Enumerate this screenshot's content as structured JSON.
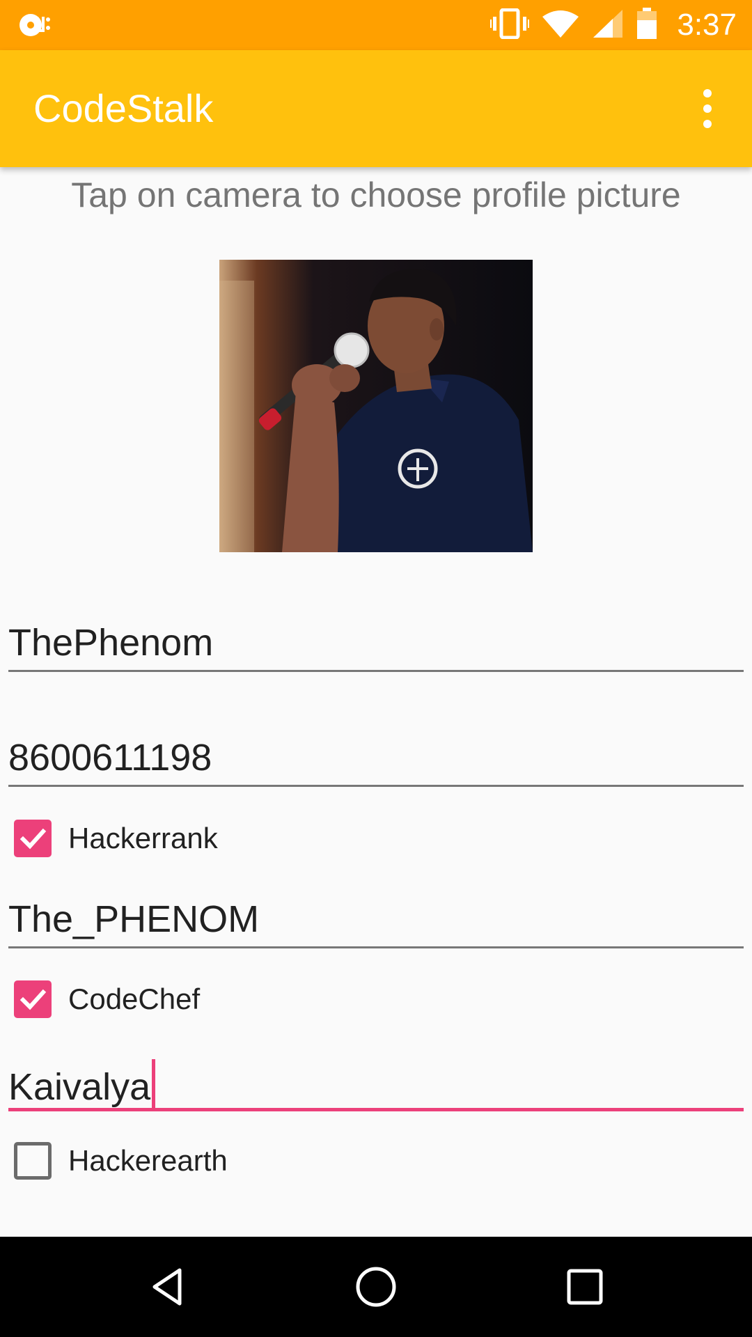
{
  "status_bar": {
    "time": "3:37",
    "left_icon": "cd-notification-icon",
    "right_icons": [
      "vibrate-icon",
      "wifi-icon",
      "cell-signal-icon",
      "battery-icon"
    ],
    "color": "#ffa000"
  },
  "app_bar": {
    "title": "CodeStalk",
    "menu_icon": "overflow-menu-icon",
    "color": "#ffc10d"
  },
  "hint_text": "Tap on camera to choose profile picture",
  "fields": {
    "name": "ThePhenom",
    "phone": "8600611198",
    "hackerrank_handle": "The_PHENOM",
    "codechef_handle": "Kaivalya"
  },
  "checkboxes": {
    "hackerrank": {
      "label": "Hackerrank",
      "checked": true
    },
    "codechef": {
      "label": "CodeChef",
      "checked": true
    },
    "hackerearth": {
      "label": "Hackerearth",
      "checked": false
    }
  },
  "colors": {
    "accent": "#ec407a",
    "background": "#fafafa",
    "hint": "#757575"
  },
  "nav_bar": {
    "icons": [
      "back-icon",
      "home-icon",
      "recents-icon"
    ]
  }
}
